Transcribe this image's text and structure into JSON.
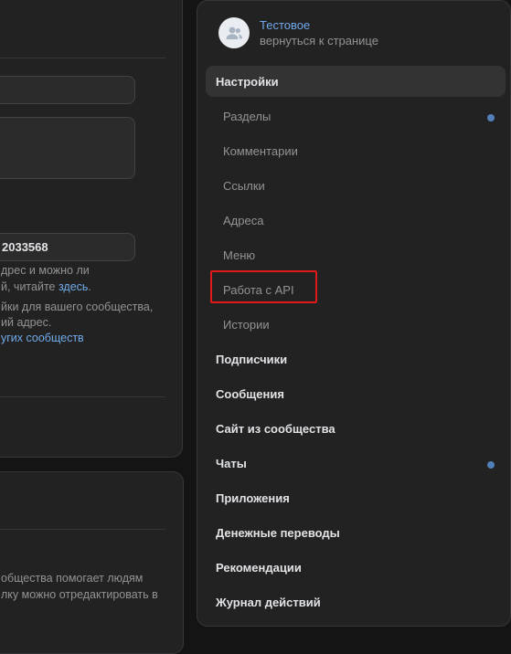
{
  "left": {
    "address_value": "2033568",
    "help_line1": "дрес и можно ли",
    "help_line2_prefix": "й, читайте ",
    "help_line2_link": "здесь",
    "help_line2_suffix": ".",
    "help_line3": "йки для вашего сообщества,",
    "help_line4": "ий адрес.",
    "help_link2": "угих сообществ",
    "bottom_line1": "общества помогает людям",
    "bottom_line2": "лку можно отредактировать в"
  },
  "community": {
    "name": "Тестовое",
    "back_link": "вернуться к странице",
    "avatar_icon": "users-icon"
  },
  "nav": {
    "settings": "Настройки",
    "sections": "Разделы",
    "comments": "Комментарии",
    "links": "Ссылки",
    "addresses": "Адреса",
    "menu": "Меню",
    "api": "Работа с API",
    "stories": "Истории",
    "subscribers": "Подписчики",
    "messages": "Сообщения",
    "site": "Сайт из сообщества",
    "chats": "Чаты",
    "apps": "Приложения",
    "transfers": "Денежные переводы",
    "recommendations": "Рекомендации",
    "log": "Журнал действий"
  },
  "colors": {
    "accent": "#71aaeb",
    "dot": "#5181b8",
    "highlight": "#e01a1a"
  }
}
